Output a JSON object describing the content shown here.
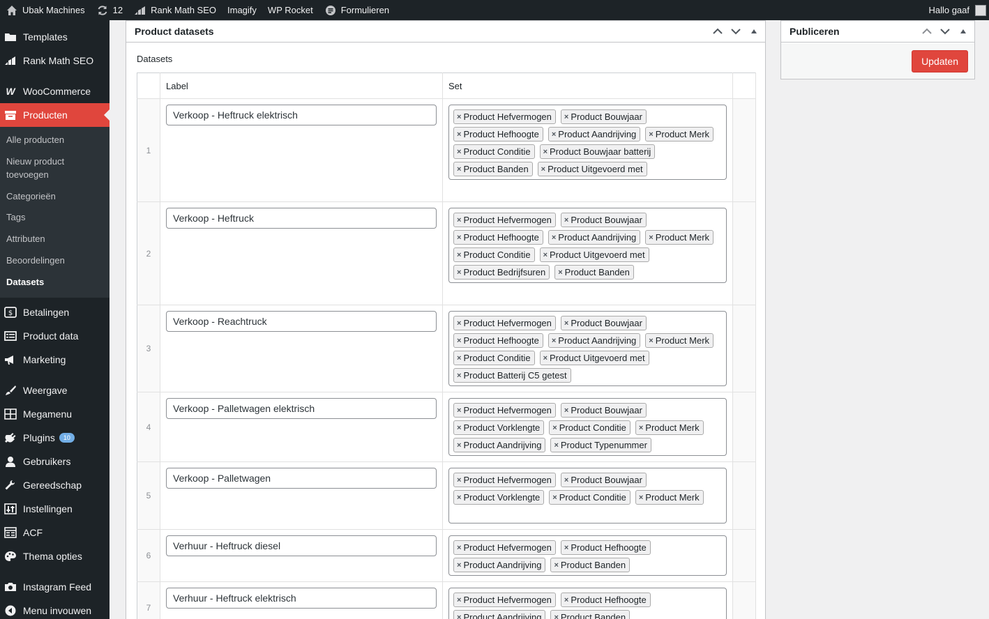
{
  "admin_bar": {
    "site_name": "Ubak Machines",
    "updates_count": "12",
    "rank_math": "Rank Math SEO",
    "imagify": "Imagify",
    "wp_rocket": "WP Rocket",
    "formulieren": "Formulieren",
    "greeting": "Hallo gaaf"
  },
  "sidebar": {
    "templates": "Templates",
    "rank_math": "Rank Math SEO",
    "woocommerce": "WooCommerce",
    "producten": "Producten",
    "submenu": [
      "Alle producten",
      "Nieuw product toevoegen",
      "Categorieën",
      "Tags",
      "Attributen",
      "Beoordelingen",
      "Datasets"
    ],
    "betalingen": "Betalingen",
    "product_data": "Product data",
    "marketing": "Marketing",
    "weergave": "Weergave",
    "megamenu": "Megamenu",
    "plugins": "Plugins",
    "plugins_badge": "10",
    "gebruikers": "Gebruikers",
    "gereedschap": "Gereedschap",
    "instellingen": "Instellingen",
    "acf": "ACF",
    "thema_opties": "Thema opties",
    "instagram_feed": "Instagram Feed",
    "menu_invouwen": "Menu invouwen"
  },
  "datasets_box": {
    "title": "Product datasets",
    "field_label": "Datasets",
    "col_label": "Label",
    "col_set": "Set",
    "rows": [
      {
        "num": "1",
        "label": "Verkoop - Heftruck elektrisch",
        "tags": [
          "Product Hefvermogen",
          "Product Bouwjaar",
          "Product Hefhoogte",
          "Product Aandrijving",
          "Product Merk",
          "Product Conditie",
          "Product Bouwjaar batterij",
          "Product Banden",
          "Product Uitgevoerd met"
        ]
      },
      {
        "num": "2",
        "label": "Verkoop - Heftruck",
        "tags": [
          "Product Hefvermogen",
          "Product Bouwjaar",
          "Product Hefhoogte",
          "Product Aandrijving",
          "Product Merk",
          "Product Conditie",
          "Product Uitgevoerd met",
          "Product Bedrijfsuren",
          "Product Banden"
        ]
      },
      {
        "num": "3",
        "label": "Verkoop - Reachtruck",
        "tags": [
          "Product Hefvermogen",
          "Product Bouwjaar",
          "Product Hefhoogte",
          "Product Aandrijving",
          "Product Merk",
          "Product Conditie",
          "Product Uitgevoerd met",
          "Product Batterij C5 getest"
        ]
      },
      {
        "num": "4",
        "label": "Verkoop - Palletwagen elektrisch",
        "tags": [
          "Product Hefvermogen",
          "Product Bouwjaar",
          "Product Vorklengte",
          "Product Conditie",
          "Product Merk",
          "Product Aandrijving",
          "Product Typenummer"
        ]
      },
      {
        "num": "5",
        "label": "Verkoop - Palletwagen",
        "tags": [
          "Product Hefvermogen",
          "Product Bouwjaar",
          "Product Vorklengte",
          "Product Conditie",
          "Product Merk"
        ]
      },
      {
        "num": "6",
        "label": "Verhuur - Heftruck diesel",
        "tags": [
          "Product Hefvermogen",
          "Product Hefhoogte",
          "Product Aandrijving",
          "Product Banden"
        ]
      },
      {
        "num": "7",
        "label": "Verhuur - Heftruck elektrisch",
        "tags": [
          "Product Hefvermogen",
          "Product Hefhoogte",
          "Product Aandrijving",
          "Product Banden"
        ]
      }
    ]
  },
  "publish_box": {
    "title": "Publiceren",
    "update_button": "Updaten"
  },
  "colors": {
    "accent": "#e0463d",
    "admin_dark": "#1d2327",
    "badge": "#72aee6"
  }
}
